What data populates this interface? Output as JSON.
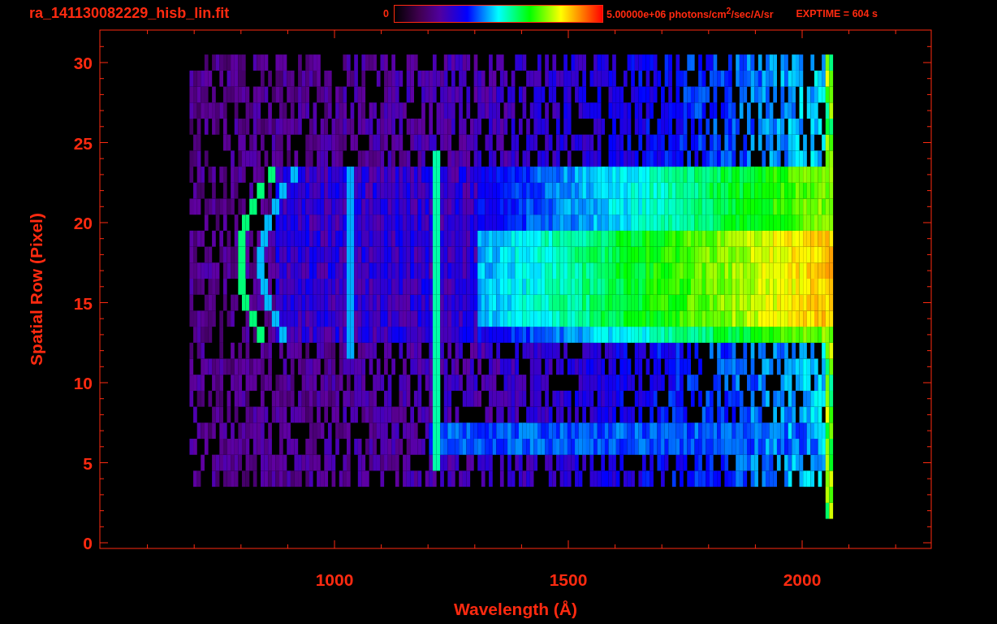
{
  "header": {
    "title": "ra_141130082229_hisb_lin.fit",
    "colorbar": {
      "min_label": "0",
      "max_label": "5.00000e+06 photons/cm$^{2}$/sec/A/sr"
    },
    "exposure": "EXPTIME = 604 s"
  },
  "plot": {
    "xlabel": "Wavelength (Å)",
    "ylabel": "Spatial Row (Pixel)",
    "xticks": [
      "1000",
      "1500",
      "2000"
    ],
    "yticks": [
      "30",
      "25",
      "20",
      "15",
      "10",
      "5",
      "0"
    ]
  }
}
